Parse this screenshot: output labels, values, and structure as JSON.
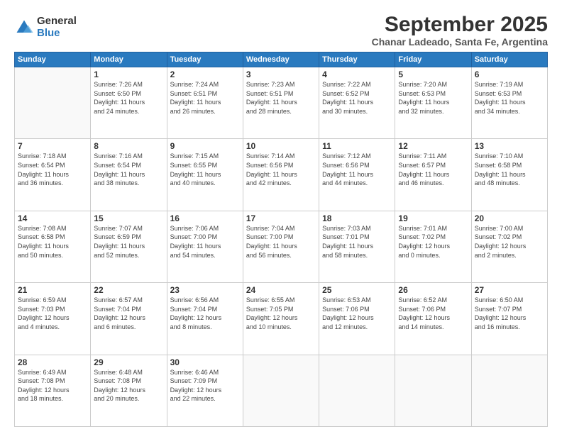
{
  "header": {
    "logo_general": "General",
    "logo_blue": "Blue",
    "month_title": "September 2025",
    "subtitle": "Chanar Ladeado, Santa Fe, Argentina"
  },
  "days_of_week": [
    "Sunday",
    "Monday",
    "Tuesday",
    "Wednesday",
    "Thursday",
    "Friday",
    "Saturday"
  ],
  "weeks": [
    [
      {
        "day": "",
        "info": ""
      },
      {
        "day": "1",
        "info": "Sunrise: 7:26 AM\nSunset: 6:50 PM\nDaylight: 11 hours\nand 24 minutes."
      },
      {
        "day": "2",
        "info": "Sunrise: 7:24 AM\nSunset: 6:51 PM\nDaylight: 11 hours\nand 26 minutes."
      },
      {
        "day": "3",
        "info": "Sunrise: 7:23 AM\nSunset: 6:51 PM\nDaylight: 11 hours\nand 28 minutes."
      },
      {
        "day": "4",
        "info": "Sunrise: 7:22 AM\nSunset: 6:52 PM\nDaylight: 11 hours\nand 30 minutes."
      },
      {
        "day": "5",
        "info": "Sunrise: 7:20 AM\nSunset: 6:53 PM\nDaylight: 11 hours\nand 32 minutes."
      },
      {
        "day": "6",
        "info": "Sunrise: 7:19 AM\nSunset: 6:53 PM\nDaylight: 11 hours\nand 34 minutes."
      }
    ],
    [
      {
        "day": "7",
        "info": "Sunrise: 7:18 AM\nSunset: 6:54 PM\nDaylight: 11 hours\nand 36 minutes."
      },
      {
        "day": "8",
        "info": "Sunrise: 7:16 AM\nSunset: 6:54 PM\nDaylight: 11 hours\nand 38 minutes."
      },
      {
        "day": "9",
        "info": "Sunrise: 7:15 AM\nSunset: 6:55 PM\nDaylight: 11 hours\nand 40 minutes."
      },
      {
        "day": "10",
        "info": "Sunrise: 7:14 AM\nSunset: 6:56 PM\nDaylight: 11 hours\nand 42 minutes."
      },
      {
        "day": "11",
        "info": "Sunrise: 7:12 AM\nSunset: 6:56 PM\nDaylight: 11 hours\nand 44 minutes."
      },
      {
        "day": "12",
        "info": "Sunrise: 7:11 AM\nSunset: 6:57 PM\nDaylight: 11 hours\nand 46 minutes."
      },
      {
        "day": "13",
        "info": "Sunrise: 7:10 AM\nSunset: 6:58 PM\nDaylight: 11 hours\nand 48 minutes."
      }
    ],
    [
      {
        "day": "14",
        "info": "Sunrise: 7:08 AM\nSunset: 6:58 PM\nDaylight: 11 hours\nand 50 minutes."
      },
      {
        "day": "15",
        "info": "Sunrise: 7:07 AM\nSunset: 6:59 PM\nDaylight: 11 hours\nand 52 minutes."
      },
      {
        "day": "16",
        "info": "Sunrise: 7:06 AM\nSunset: 7:00 PM\nDaylight: 11 hours\nand 54 minutes."
      },
      {
        "day": "17",
        "info": "Sunrise: 7:04 AM\nSunset: 7:00 PM\nDaylight: 11 hours\nand 56 minutes."
      },
      {
        "day": "18",
        "info": "Sunrise: 7:03 AM\nSunset: 7:01 PM\nDaylight: 11 hours\nand 58 minutes."
      },
      {
        "day": "19",
        "info": "Sunrise: 7:01 AM\nSunset: 7:02 PM\nDaylight: 12 hours\nand 0 minutes."
      },
      {
        "day": "20",
        "info": "Sunrise: 7:00 AM\nSunset: 7:02 PM\nDaylight: 12 hours\nand 2 minutes."
      }
    ],
    [
      {
        "day": "21",
        "info": "Sunrise: 6:59 AM\nSunset: 7:03 PM\nDaylight: 12 hours\nand 4 minutes."
      },
      {
        "day": "22",
        "info": "Sunrise: 6:57 AM\nSunset: 7:04 PM\nDaylight: 12 hours\nand 6 minutes."
      },
      {
        "day": "23",
        "info": "Sunrise: 6:56 AM\nSunset: 7:04 PM\nDaylight: 12 hours\nand 8 minutes."
      },
      {
        "day": "24",
        "info": "Sunrise: 6:55 AM\nSunset: 7:05 PM\nDaylight: 12 hours\nand 10 minutes."
      },
      {
        "day": "25",
        "info": "Sunrise: 6:53 AM\nSunset: 7:06 PM\nDaylight: 12 hours\nand 12 minutes."
      },
      {
        "day": "26",
        "info": "Sunrise: 6:52 AM\nSunset: 7:06 PM\nDaylight: 12 hours\nand 14 minutes."
      },
      {
        "day": "27",
        "info": "Sunrise: 6:50 AM\nSunset: 7:07 PM\nDaylight: 12 hours\nand 16 minutes."
      }
    ],
    [
      {
        "day": "28",
        "info": "Sunrise: 6:49 AM\nSunset: 7:08 PM\nDaylight: 12 hours\nand 18 minutes."
      },
      {
        "day": "29",
        "info": "Sunrise: 6:48 AM\nSunset: 7:08 PM\nDaylight: 12 hours\nand 20 minutes."
      },
      {
        "day": "30",
        "info": "Sunrise: 6:46 AM\nSunset: 7:09 PM\nDaylight: 12 hours\nand 22 minutes."
      },
      {
        "day": "",
        "info": ""
      },
      {
        "day": "",
        "info": ""
      },
      {
        "day": "",
        "info": ""
      },
      {
        "day": "",
        "info": ""
      }
    ]
  ]
}
